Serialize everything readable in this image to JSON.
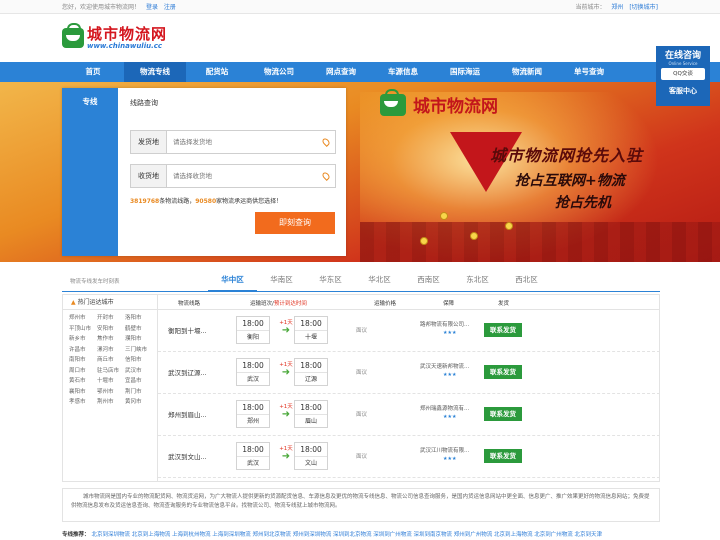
{
  "topbar": {
    "greeting": "您好，欢迎使用城市物流网！",
    "login": "登录",
    "register": "注册",
    "current_city_label": "当前城市：",
    "current_city": "郑州",
    "switch_city": "[切换城市]"
  },
  "logo": {
    "cn": "城市物流网",
    "en": "www.chinawuliu.cc"
  },
  "nav": {
    "items": [
      "首页",
      "物流专线",
      "配货站",
      "物流公司",
      "网点查询",
      "车源信息",
      "国际海运",
      "物流新闻",
      "单号查询"
    ]
  },
  "consult": {
    "title": "在线咨询",
    "subtitle": "Online Service",
    "qq": "QQ交谈",
    "service": "客服中心"
  },
  "banner": {
    "logo_text": "城市物流网",
    "slogan1": "城市物流网抢先入驻",
    "slogan2": "抢占互联网+物流",
    "slogan3": "抢占先机"
  },
  "query": {
    "tab": "专线",
    "title": "线路查询",
    "from_label": "发货地",
    "from_placeholder": "请选择发货地",
    "to_label": "收货地",
    "to_placeholder": "请选择收货地",
    "lines_count": "3819768",
    "lines_text": "条物流线路，",
    "companies_count": "90580",
    "companies_text": "家物流承运商供您选择！",
    "button": "即刻查询"
  },
  "regions": {
    "caption": "物流专线发车时刻表",
    "tabs": [
      "华中区",
      "华南区",
      "华东区",
      "华北区",
      "西南区",
      "东北区",
      "西北区"
    ]
  },
  "cities": {
    "title": "热门运达城市",
    "list": [
      "郑州市",
      "开封市",
      "洛阳市",
      "平顶山市",
      "安阳市",
      "鹤壁市",
      "新乡市",
      "焦作市",
      "濮阳市",
      "许昌市",
      "漯河市",
      "三门峡市",
      "南阳市",
      "商丘市",
      "信阳市",
      "周口市",
      "驻马店市",
      "武汉市",
      "黄石市",
      "十堰市",
      "宜昌市",
      "襄阳市",
      "鄂州市",
      "荆门市",
      "孝感市",
      "荆州市",
      "黄冈市"
    ]
  },
  "routes": {
    "headers": {
      "line": "物流线路",
      "time": "运输班次",
      "sep": "/",
      "duration": "预计到达时间",
      "price": "运输价格",
      "guarantee": "保障",
      "ship": "发货"
    },
    "rows": [
      {
        "name": "衡阳到十堰...",
        "depart": "18:00",
        "from": "衡阳",
        "days": "+1天",
        "arrive": "18:00",
        "to": "十堰",
        "price": "面议",
        "company": "路邦物流有限公司...",
        "button": "联系发货"
      },
      {
        "name": "武汉到辽源...",
        "depart": "18:00",
        "from": "武汉",
        "days": "+1天",
        "arrive": "18:00",
        "to": "辽源",
        "price": "面议",
        "company": "武汉天速新邦物流...",
        "button": "联系发货"
      },
      {
        "name": "郑州到眉山...",
        "depart": "18:00",
        "from": "郑州",
        "days": "+1天",
        "arrive": "18:00",
        "to": "眉山",
        "price": "面议",
        "company": "郑州瑞鑫源物流有...",
        "button": "联系发货"
      },
      {
        "name": "武汉到文山...",
        "depart": "18:00",
        "from": "武汉",
        "days": "+1天",
        "arrive": "18:00",
        "to": "文山",
        "price": "面议",
        "company": "武汉江川物流有限...",
        "button": "联系发货"
      }
    ]
  },
  "intro": "城市物流网是国内专业的物流配货网、物流货运网，为广大物流人提供更新的货源配货信息、车源信息及更优的物流专线信息、物流公司信息查询服务，是国内货运信息网站中更全面、信息更广、推广效果更好的物流信息网站；免费提供物流信息发布及货运信息查询、物流查询服务的专业物流信息平台。找物流公司、物流专线就上城市物流网。",
  "links": {
    "label": "专线推荐：",
    "text": "北京到深圳物流 北京到上海物流 上海到杭州物流 上海到深圳物流 郑州到北京物流 郑州到深圳物流 深圳到北京物流 深圳到广州物流 深圳到南京物流 郑州到广州物流 北京到上海物流 北京到广州物流 北京到天津"
  }
}
